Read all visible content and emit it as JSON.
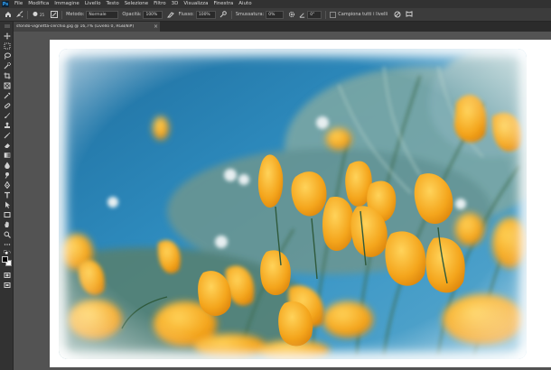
{
  "app": {
    "logo_text": "Ps"
  },
  "menu": [
    "File",
    "Modifica",
    "Immagine",
    "Livello",
    "Testo",
    "Selezione",
    "Filtro",
    "3D",
    "Visualizza",
    "Finestra",
    "Aiuto"
  ],
  "options": {
    "brush_size": "25",
    "mode_label": "Metodo:",
    "mode_value": "Normale",
    "opacity_label": "Opacità:",
    "opacity_value": "100%",
    "flow_label": "Flusso:",
    "flow_value": "100%",
    "smoothing_label": "Smussatura:",
    "smoothing_value": "0%",
    "angle_value": "0°",
    "sample_all_label": "Campiona tutti i livelli"
  },
  "document": {
    "tab_title": "sfondo-vignetta-cerchio.jpg @ 16,7% (Livello 0, RGB/8#)",
    "close": "×"
  },
  "colors": {
    "foreground": "#000000",
    "background": "#ffffff",
    "sky": "#2f86b8",
    "petal": "#f4a51c"
  }
}
